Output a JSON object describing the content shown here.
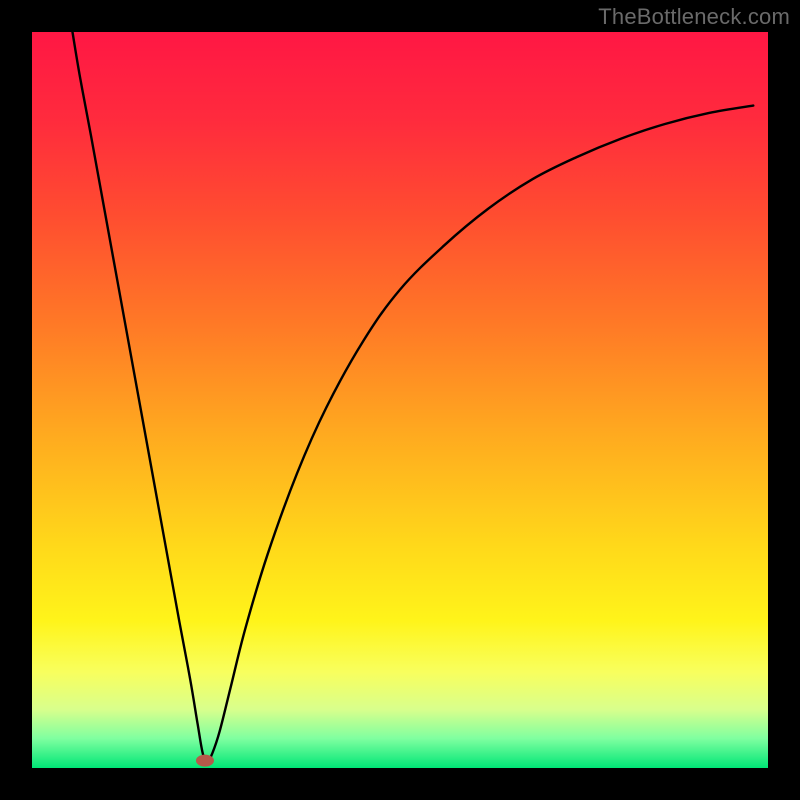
{
  "watermark": "TheBottleneck.com",
  "chart_data": {
    "type": "line",
    "title": "",
    "xlabel": "",
    "ylabel": "",
    "xlim": [
      0,
      100
    ],
    "ylim": [
      0,
      100
    ],
    "border_color": "#000000",
    "curve_color": "#000000",
    "marker": {
      "x": 23.5,
      "y": 1,
      "color": "#b55a4a"
    },
    "gradient_stops": [
      {
        "offset": 0,
        "color": "#ff1744"
      },
      {
        "offset": 12,
        "color": "#ff2b3d"
      },
      {
        "offset": 25,
        "color": "#ff4d30"
      },
      {
        "offset": 40,
        "color": "#ff7a26"
      },
      {
        "offset": 55,
        "color": "#ffab1f"
      },
      {
        "offset": 70,
        "color": "#ffd91a"
      },
      {
        "offset": 80,
        "color": "#fff41a"
      },
      {
        "offset": 87,
        "color": "#f8ff5e"
      },
      {
        "offset": 92,
        "color": "#d9ff8c"
      },
      {
        "offset": 96,
        "color": "#7fffa0"
      },
      {
        "offset": 100,
        "color": "#00e676"
      }
    ],
    "series": [
      {
        "name": "bottleneck-curve",
        "points": [
          {
            "x": 5.5,
            "y": 100
          },
          {
            "x": 6.5,
            "y": 94
          },
          {
            "x": 8,
            "y": 86
          },
          {
            "x": 10,
            "y": 75
          },
          {
            "x": 12,
            "y": 64
          },
          {
            "x": 14,
            "y": 53
          },
          {
            "x": 16,
            "y": 42
          },
          {
            "x": 18,
            "y": 31
          },
          {
            "x": 20,
            "y": 20
          },
          {
            "x": 21.5,
            "y": 12
          },
          {
            "x": 22.5,
            "y": 6
          },
          {
            "x": 23.2,
            "y": 2
          },
          {
            "x": 23.8,
            "y": 0.8
          },
          {
            "x": 24.5,
            "y": 2
          },
          {
            "x": 25.5,
            "y": 5
          },
          {
            "x": 27,
            "y": 11
          },
          {
            "x": 29,
            "y": 19
          },
          {
            "x": 32,
            "y": 29
          },
          {
            "x": 36,
            "y": 40
          },
          {
            "x": 40,
            "y": 49
          },
          {
            "x": 45,
            "y": 58
          },
          {
            "x": 50,
            "y": 65
          },
          {
            "x": 56,
            "y": 71
          },
          {
            "x": 62,
            "y": 76
          },
          {
            "x": 68,
            "y": 80
          },
          {
            "x": 74,
            "y": 83
          },
          {
            "x": 80,
            "y": 85.5
          },
          {
            "x": 86,
            "y": 87.5
          },
          {
            "x": 92,
            "y": 89
          },
          {
            "x": 98,
            "y": 90
          }
        ]
      }
    ]
  }
}
